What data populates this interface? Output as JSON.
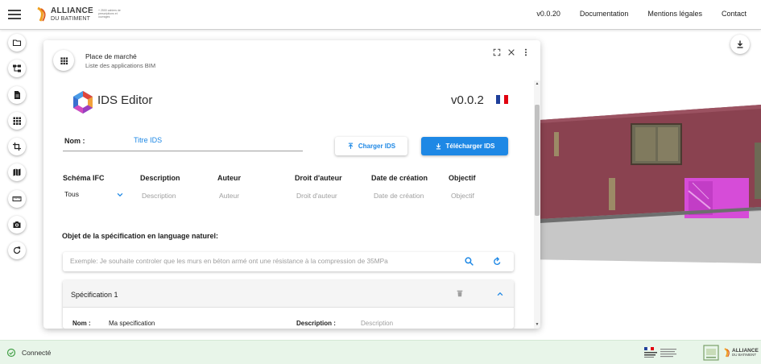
{
  "header": {
    "logo_main": "ALLIANCE",
    "logo_sub": "DU BATIMENT",
    "logo_tag": "+ 2500 cahiers de prescriptions et ouvrages",
    "nav": [
      "v0.0.20",
      "Documentation",
      "Mentions légales",
      "Contact"
    ]
  },
  "toolbar": {
    "icons": [
      "folder-icon",
      "tree-structure-icon",
      "document-icon",
      "apps-grid-icon",
      "crop-icon",
      "map-icon",
      "ruler-icon",
      "camera-icon",
      "refresh-icon"
    ]
  },
  "panel": {
    "title": "Place de marché",
    "subtitle": "Liste des applications BIM",
    "app_name": "IDS Editor",
    "version": "v0.0.2",
    "flag_colors": [
      "#1f3f9a",
      "#ffffff",
      "#e1000f"
    ],
    "name_label": "Nom :",
    "name_value": "Titre IDS",
    "load_button": "Charger IDS",
    "download_button": "Télécharger IDS",
    "fields": [
      {
        "header": "Schéma IFC",
        "value": "Tous"
      },
      {
        "header": "Description",
        "placeholder": "Description"
      },
      {
        "header": "Auteur",
        "placeholder": "Auteur"
      },
      {
        "header": "Droit d'auteur",
        "placeholder": "Droit d'auteur"
      },
      {
        "header": "Date de création",
        "placeholder": "Date de création"
      },
      {
        "header": "Objectif",
        "placeholder": "Objectif"
      }
    ],
    "spec_natural_label": "Objet de la spécification en language naturel:",
    "search_placeholder": "Exemple: Je souhaite controler que les murs en béton armé ont une résistance à la compression de 35MPa",
    "spec_card": {
      "title": "Spécification 1",
      "name_label": "Nom :",
      "name_value": "Ma specification",
      "desc_label": "Description :",
      "desc_placeholder": "Description"
    }
  },
  "status": {
    "text": "Connecté",
    "accent": "#43a047"
  },
  "colors": {
    "primary": "#1e88e5",
    "wall": "#8a4250",
    "highlight": "#d64cd8"
  }
}
